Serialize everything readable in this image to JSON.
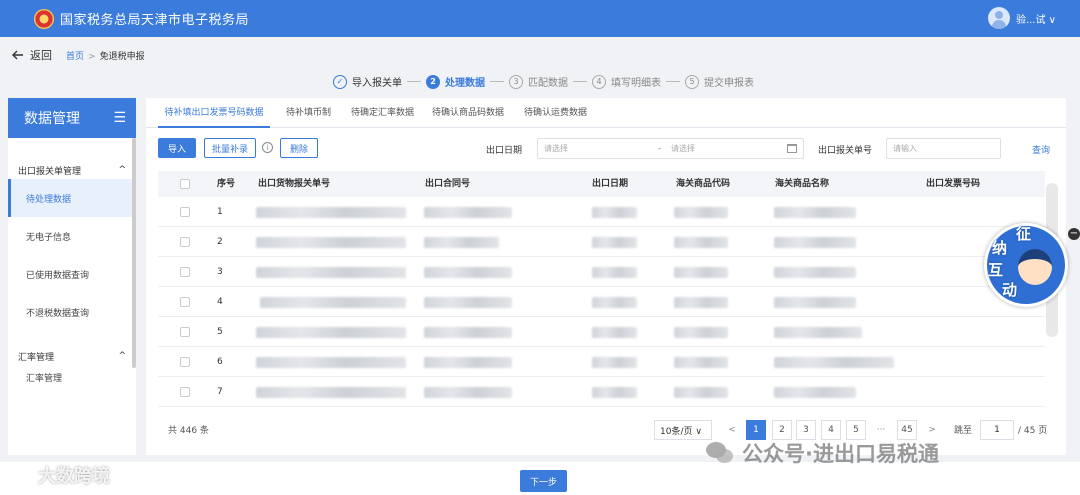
{
  "header": {
    "title": "国家税务总局天津市电子税务局",
    "user": "验...试 ∨"
  },
  "nav": {
    "back": "返回",
    "crumbs": [
      "首页",
      "免退税申报"
    ],
    "crumb_sep": ">"
  },
  "steps": [
    {
      "num": "✓",
      "label": "导入报关单"
    },
    {
      "num": "2",
      "label": "处理数据"
    },
    {
      "num": "3",
      "label": "匹配数据"
    },
    {
      "num": "4",
      "label": "填写明细表"
    },
    {
      "num": "5",
      "label": "提交申报表"
    }
  ],
  "sidebar": {
    "title": "数据管理",
    "toggle_icon": "☰",
    "groups": [
      {
        "label": "出口报关单管理",
        "arrow": "^",
        "items": [
          "待处理数据",
          "无电子信息",
          "已使用数据查询",
          "不退税数据查询"
        ]
      },
      {
        "label": "汇率管理",
        "arrow": "^",
        "items": [
          "汇率管理"
        ]
      }
    ]
  },
  "tabs": [
    "待补填出口发票号码数据",
    "待补填币制",
    "待确定汇率数据",
    "待确认商品码数据",
    "待确认运费数据"
  ],
  "toolbar": {
    "import": "导入",
    "batch": "批量补录",
    "info": "i",
    "delete": "删除"
  },
  "filters": {
    "date_label": "出口日期",
    "date_start_placeholder": "请选择",
    "date_sep": "-",
    "date_end_placeholder": "请选择",
    "decl_label": "出口报关单号",
    "decl_placeholder": "请输入",
    "query": "查询"
  },
  "table": {
    "columns": [
      "序号",
      "出口货物报关单号",
      "出口合同号",
      "出口日期",
      "海关商品代码",
      "海关商品名称",
      "出口发票号码"
    ],
    "rows": [
      "1",
      "2",
      "3",
      "4",
      "5",
      "6",
      "7"
    ]
  },
  "pagination": {
    "total": "共 446 条",
    "page_size": "10条/页 ∨",
    "prev": "<",
    "pages": [
      "1",
      "2",
      "3",
      "4",
      "5"
    ],
    "ellipsis": "···",
    "last": "45",
    "next": ">",
    "jump_label": "跳至",
    "jump_value": "1",
    "of_pages": "/ 45 页",
    "current": 1
  },
  "mascot": {
    "chars": [
      "征",
      "纳",
      "互",
      "动"
    ],
    "close": "−"
  },
  "footer": {
    "next": "下一步"
  },
  "watermarks": {
    "left": "大数跨境",
    "right": "公众号·进出口易税通"
  },
  "colors": {
    "primary": "#3a7bdc",
    "background": "#f0f2f5"
  }
}
